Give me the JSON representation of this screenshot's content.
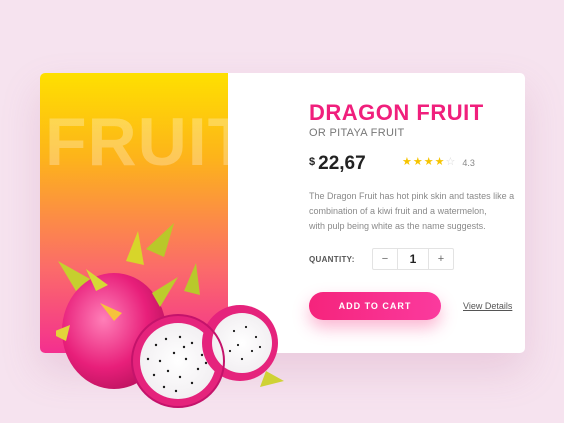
{
  "hero": {
    "watermark": "FRUIT"
  },
  "product": {
    "title": "DRAGON FRUIT",
    "subtitle": "OR PITAYA FRUIT",
    "currency": "$",
    "price": "22,67",
    "rating": 4.3,
    "rating_label": "4.3",
    "stars_filled": 4,
    "stars_total": 5,
    "description_lines": [
      "The Dragon Fruit has hot pink skin and tastes like a",
      "combination of a kiwi fruit and a watermelon,",
      "with pulp being white as the name suggests."
    ]
  },
  "quantity": {
    "label": "QUANTITY:",
    "minus": "−",
    "value": "1",
    "plus": "+"
  },
  "actions": {
    "add_to_cart": "ADD TO CART",
    "view_details": "View Details"
  },
  "colors": {
    "accent": "#f01f7c",
    "star": "#f6c400",
    "gradient_top": "#fee000",
    "gradient_bottom": "#f42f8f"
  }
}
